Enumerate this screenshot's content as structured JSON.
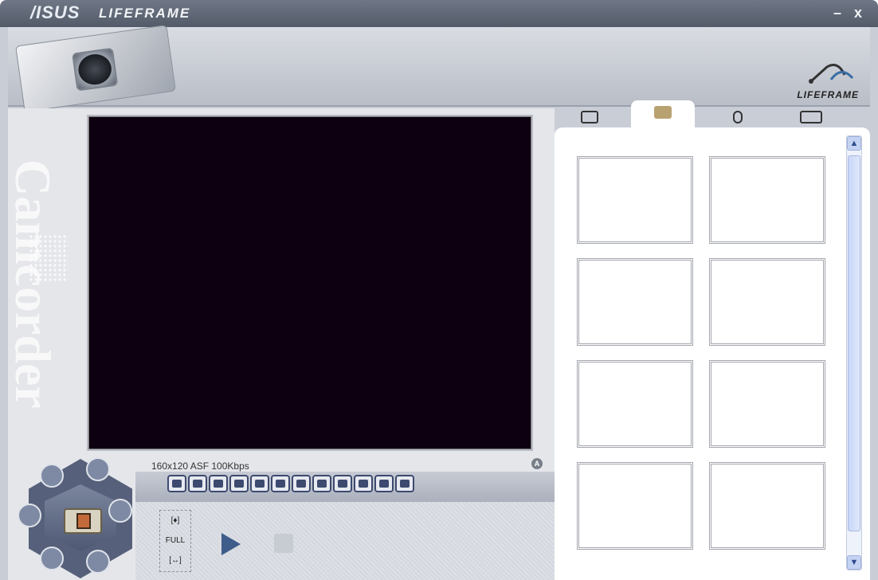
{
  "window": {
    "brand": "/ISUS",
    "app_title": "LIFEFRAME",
    "minimize_label": "–",
    "close_label": "x"
  },
  "banner": {
    "logo_text": "LIFEFRAME"
  },
  "side_watermark": "Camcorder",
  "preview": {
    "status_text": "160x120  ASF  100Kbps",
    "lock_label": "A"
  },
  "toolbar": {
    "tools": [
      "image-icon",
      "timer-icon",
      "edit-icon",
      "text-icon",
      "contrast-icon",
      "frame-icon",
      "brightness-icon",
      "saturation-icon",
      "list-icon",
      "color-icon",
      "effect-icon",
      "settings-icon"
    ]
  },
  "controls": {
    "top_label": "[♦]",
    "full_label": "FULL",
    "bottom_label": "[↔]"
  },
  "tabs": [
    {
      "name": "camera-tab",
      "icon": "camera-icon",
      "active": false
    },
    {
      "name": "camcorder-tab",
      "icon": "camcorder-icon",
      "active": true
    },
    {
      "name": "microphone-tab",
      "icon": "microphone-icon",
      "active": false
    },
    {
      "name": "eye-tab",
      "icon": "eye-icon",
      "active": false
    }
  ],
  "thumbnails_count": 8,
  "scroll": {
    "up": "▲",
    "down": "▼"
  }
}
